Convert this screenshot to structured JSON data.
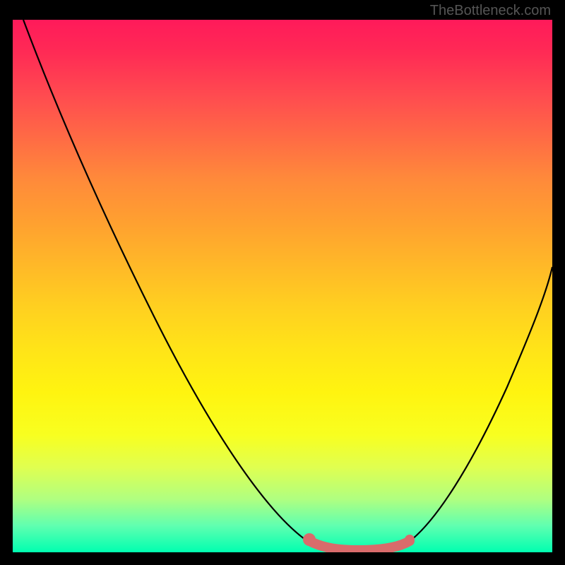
{
  "watermark": "TheBottleneck.com",
  "chart_data": {
    "type": "line",
    "title": "",
    "xlabel": "",
    "ylabel": "",
    "xlim": [
      0,
      100
    ],
    "ylim": [
      0,
      100
    ],
    "series": [
      {
        "name": "bottleneck-curve",
        "x": [
          2,
          8,
          14,
          20,
          26,
          32,
          38,
          44,
          50,
          55,
          58,
          62,
          66,
          70,
          74,
          78,
          82,
          86,
          90,
          94,
          98
        ],
        "y": [
          100,
          90,
          80,
          70,
          60,
          50,
          40,
          30,
          20,
          10,
          5,
          2,
          1,
          1,
          2,
          5,
          12,
          22,
          34,
          46,
          58
        ]
      }
    ],
    "highlight_segment": {
      "name": "optimal-range",
      "x_start": 55,
      "x_end": 74,
      "color": "#d96b6b"
    },
    "background_gradient": {
      "top": "#ff1a5a",
      "middle": "#ffd020",
      "bottom": "#00ffb0"
    }
  }
}
